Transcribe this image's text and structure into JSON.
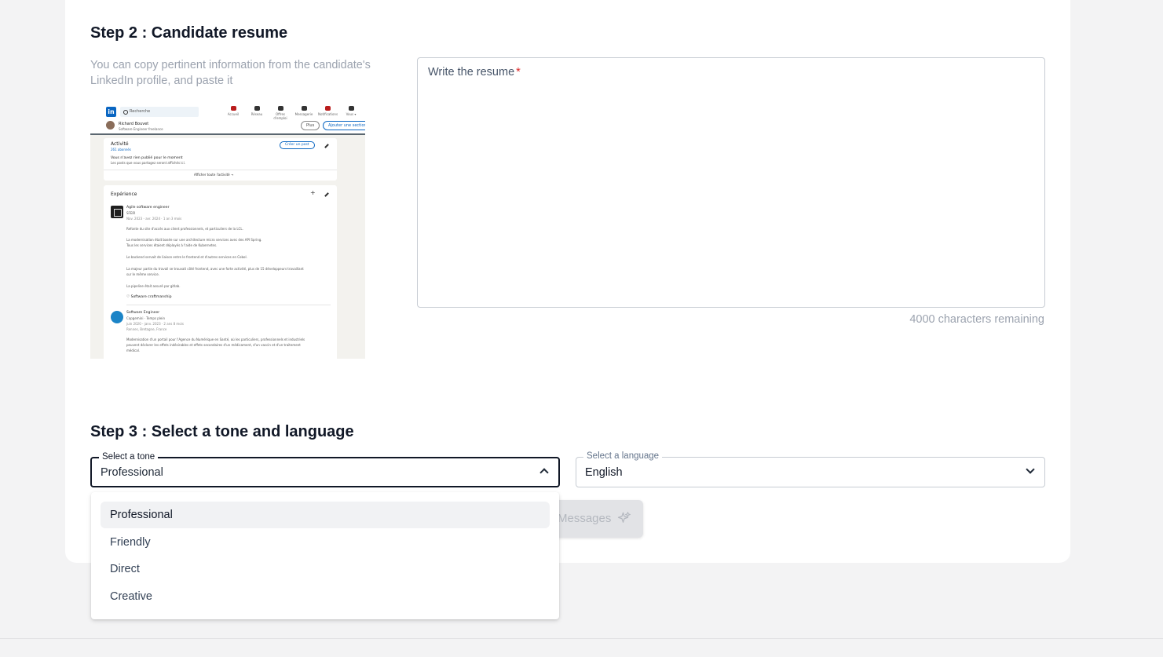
{
  "step2": {
    "title": "Step 2 : Candidate resume",
    "help": "You can copy pertinent information from the candidate's LinkedIn profile, and paste it",
    "resume_placeholder": "Write the resume",
    "required_mark": "*",
    "chars_remaining": "4000 characters remaining",
    "preview": {
      "logo": "in",
      "search": "Recherche",
      "nav": [
        "Accueil",
        "Réseau",
        "Offres d'emploi",
        "Messagerie",
        "Notifications",
        "Vous ▾"
      ],
      "profile_name": "Richard Bouvet",
      "profile_sub": "Software Engineer freelance",
      "btn_plus": "Plus",
      "btn_add": "Ajouter une section",
      "activity_title": "Activité",
      "activity_subs": "261 abonnés",
      "create_post": "Créer un post",
      "nothing": "Vous n'avez rien publié pour le moment",
      "nothing_sub": "Les posts que vous partagez seront affichés ici.",
      "show_all": "Afficher toute l'activité →",
      "exp_title": "Expérience",
      "job1_title": "Agile software engineer",
      "job1_company": "SFEIR",
      "job1_dates": "Nov. 2023 - avr. 2024 · 1 an 3 mois",
      "job1_lines": [
        "Refonte du site d'accès aux client professionnels, et particuliers de la LCL.",
        "La modernisation était basée sur une architecture micro services avec des API Spring.",
        "Tous les services étaient déployés à l'aide de Kubernetes.",
        "Le backend servait de liaison entre le frontend et d'autres services en Cobol.",
        "La majeur partie du travail se trouvait côté frontend, avec une forte activité, plus de 15 développeurs travaillant",
        "sur le même service.",
        "La pipeline était assuré par gitlab.",
        "♡ Software craftmanship"
      ],
      "job2_title": "Software Engineer",
      "job2_company": "Capgemini · Temps plein",
      "job2_dates": "juin 2020 - janv. 2023 · 2 ans 8 mois",
      "job2_location": "Rennes, Bretagne, France",
      "job2_lines": [
        "Modernisation d'un portail pour l'Agence du Numérique en Santé, où les particuliers, professionnels et industriels",
        "peuvent déclarer les effets indésirables et effets secondaires d'un médicament, d'un vaccin et d'un traitement",
        "médical."
      ]
    }
  },
  "step3": {
    "title": "Step 3 : Select a tone and language",
    "tone_label": "Select a tone",
    "tone_value": "Professional",
    "language_label": "Select a language",
    "language_value": "English",
    "generate_label": "Messages",
    "tone_options": [
      "Professional",
      "Friendly",
      "Direct",
      "Creative"
    ]
  }
}
